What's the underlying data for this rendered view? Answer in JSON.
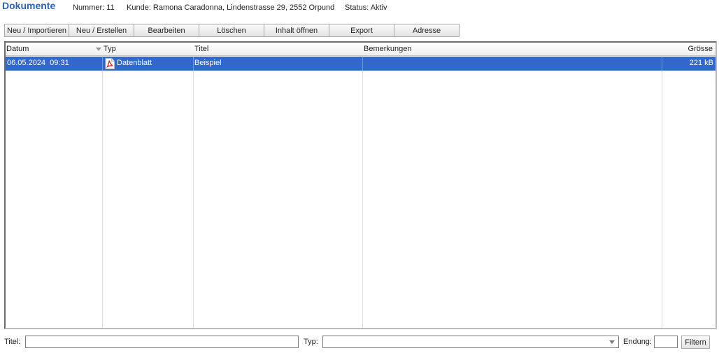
{
  "header": {
    "title": "Dokumente",
    "nummer": "Nummer: 11",
    "kunde": "Kunde: Ramona Caradonna, Lindenstrasse 29, 2552 Orpund",
    "status": "Status: Aktiv"
  },
  "toolbar": {
    "buttons": [
      "Neu / Importieren",
      "Neu / Erstellen",
      "Bearbeiten",
      "Löschen",
      "Inhalt öffnen",
      "Export",
      "Adresse"
    ]
  },
  "table": {
    "columns": [
      "Datum",
      "Typ",
      "Titel",
      "Bemerkungen",
      "Grösse"
    ],
    "sort_icon": "sort-descending-icon",
    "rows": [
      {
        "datum": "06.05.2024  09:31",
        "typ": "Datenblatt",
        "typ_icon": "pdf-icon",
        "titel": "Beispiel",
        "bemerkungen": "",
        "groesse": "221 kB",
        "selected": true
      }
    ]
  },
  "filter": {
    "titel_label": "Titel:",
    "titel_value": "",
    "typ_label": "Typ:",
    "typ_value": "",
    "endung_label": "Endung:",
    "endung_value": "",
    "button_label": "Filtern"
  },
  "colors": {
    "accent": "#2b63b8",
    "selection": "#3168c9"
  }
}
